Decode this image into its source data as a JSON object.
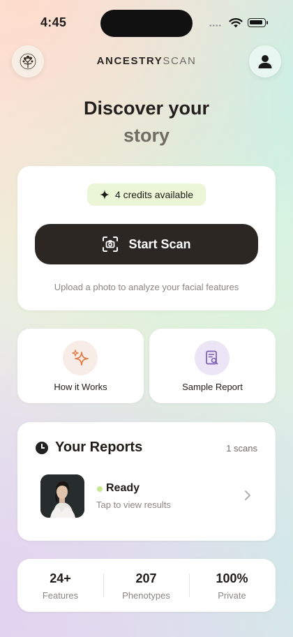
{
  "status_bar": {
    "time": "4:45",
    "signal_dots": "••••"
  },
  "header": {
    "brand_bold": "ANCESTRY",
    "brand_light": "SCAN",
    "logo_icon": "tree-icon",
    "profile_icon": "user-icon"
  },
  "hero": {
    "line1": "Discover your",
    "line2": "story"
  },
  "scan_card": {
    "credits_label": "4 credits available",
    "start_label": "Start Scan",
    "upload_hint": "Upload a photo to analyze your facial features"
  },
  "tiles": [
    {
      "label": "How it Works",
      "icon": "sparkle-icon"
    },
    {
      "label": "Sample Report",
      "icon": "document-search-icon"
    }
  ],
  "reports": {
    "title": "Your Reports",
    "count": "1 scans",
    "items": [
      {
        "status": "Ready",
        "subtitle": "Tap to view results"
      }
    ]
  },
  "stats": [
    {
      "value": "24+",
      "label": "Features"
    },
    {
      "value": "207",
      "label": "Phenotypes"
    },
    {
      "value": "100%",
      "label": "Private"
    }
  ],
  "colors": {
    "primary_dark": "#2d2723",
    "credits_bg": "#eaf6d6",
    "ready_green": "#c6e88e",
    "sparkle_orange": "#e07a45",
    "sample_purple": "#7b5fb0"
  }
}
